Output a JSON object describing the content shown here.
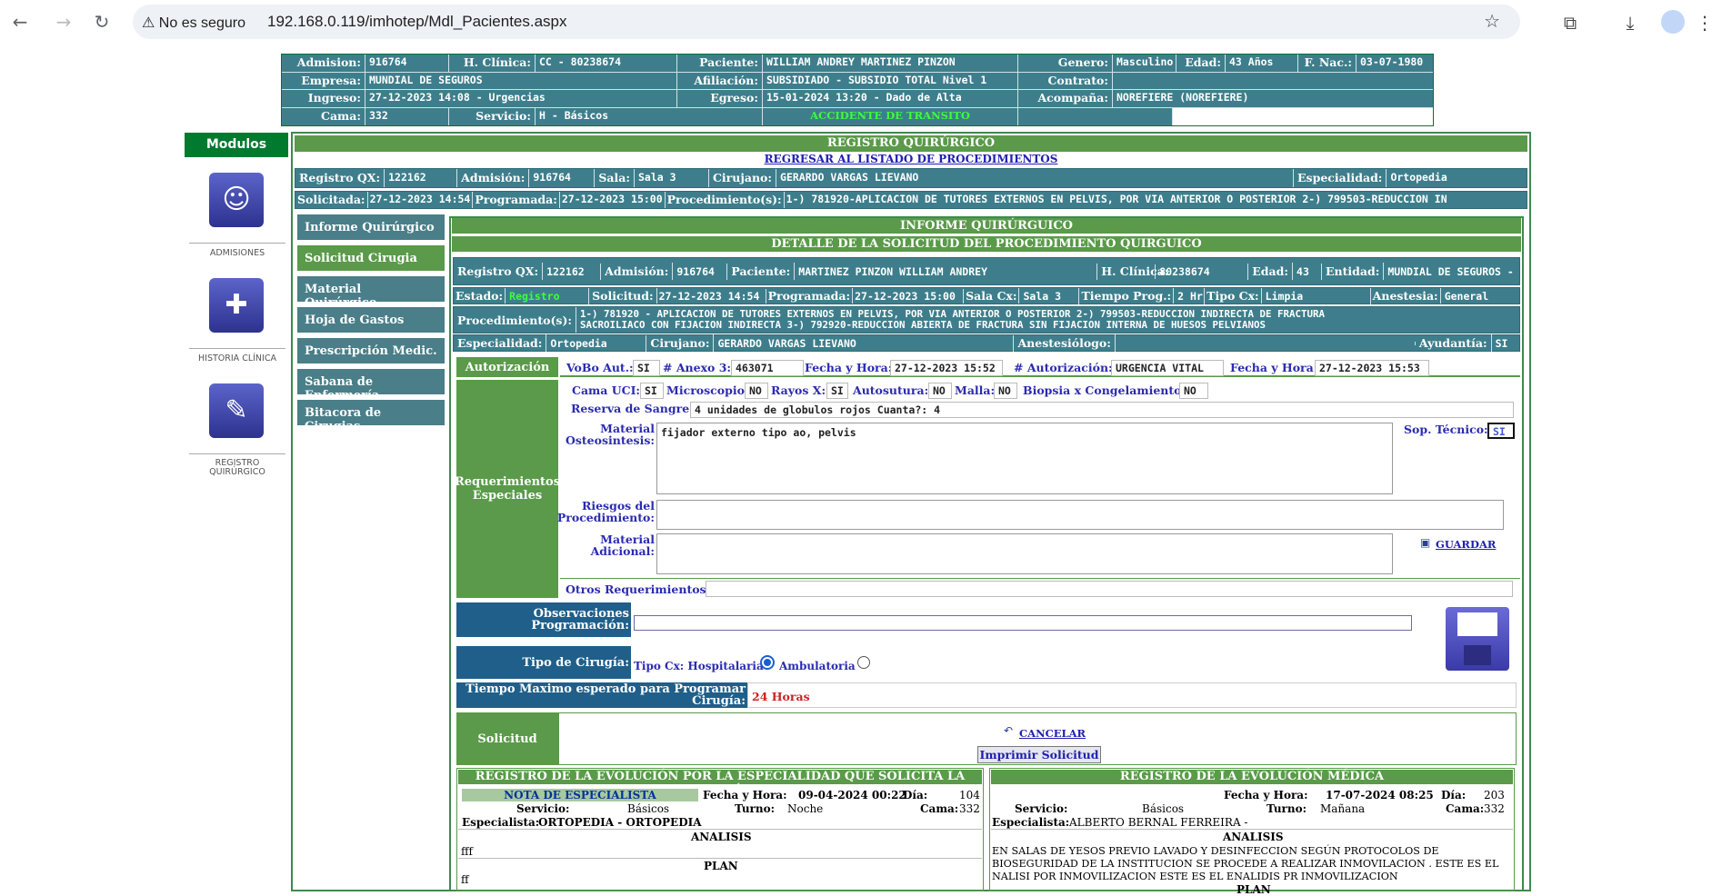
{
  "browser": {
    "secure_label": "No es seguro",
    "url": "192.168.0.119/imhotep/Mdl_Pacientes.aspx"
  },
  "patient": {
    "admision_l": "Admision:",
    "admision": "916764",
    "hclinica_l": "H. Clínica:",
    "hclinica": "CC - 80238674",
    "paciente_l": "Paciente:",
    "paciente": "WILLIAM ANDREY MARTINEZ PINZON",
    "genero_l": "Genero:",
    "genero": "Masculino",
    "edad_l": "Edad:",
    "edad": "43 Años",
    "fnac_l": "F. Nac.:",
    "fnac": "03-07-1980",
    "empresa_l": "Empresa:",
    "empresa": "MUNDIAL DE SEGUROS",
    "afiliacion_l": "Afiliación:",
    "afiliacion": "SUBSIDIADO - SUBSIDIO TOTAL Nivel 1",
    "contrato_l": "Contrato:",
    "contrato": "",
    "ingreso_l": "Ingreso:",
    "ingreso": "27-12-2023 14:08 - Urgencias",
    "egreso_l": "Egreso:",
    "egreso": "15-01-2024 13:20 - Dado de Alta",
    "acompana_l": "Acompaña:",
    "acompana": "NOREFIERE (NOREFIERE)",
    "cama_l": "Cama:",
    "cama": "332",
    "servicio_l": "Servicio:",
    "servicio": "H - Básicos",
    "accidente": "ACCIDENTE DE TRANSITO"
  },
  "modulos": {
    "title": "Modulos",
    "items": [
      {
        "label": "ADMISIONES"
      },
      {
        "label": "HISTORIA CLÍNICA"
      },
      {
        "label": "REGISTRO QUIRÚRGICO"
      }
    ]
  },
  "registro": {
    "title": "REGISTRO QUIRÚRGICO",
    "back_link": "REGRESAR AL LISTADO DE PROCEDIMIENTOS",
    "qx_l": "Registro QX:",
    "qx": "122162",
    "adm_l": "Admisión:",
    "adm": "916764",
    "sala_l": "Sala:",
    "sala": "Sala 3",
    "cirujano_l": "Cirujano:",
    "cirujano": "GERARDO VARGAS LIEVANO",
    "esp_l": "Especialidad:",
    "esp": "Ortopedia",
    "solicitada_l": "Solicitada:",
    "solicitada": "27-12-2023 14:54",
    "programada_l": "Programada:",
    "programada": "27-12-2023 15:00",
    "proc_l": "Procedimiento(s):",
    "proc": "1-) 781920-APLICACION DE TUTORES EXTERNOS EN PELVIS, POR VIA ANTERIOR O POSTERIOR 2-) 799503-REDUCCION IN"
  },
  "menu": [
    "Informe Quirúrgico",
    "Solicitud Cirugia",
    "Material Quirúrgico",
    "Hoja de Gastos",
    "Prescripción Medic.",
    "Sabana de Enfermería",
    "Bitacora de Cirugias"
  ],
  "informe": {
    "title": "INFORME QUIRÚRGUICO",
    "subtitle": "DETALLE DE LA SOLICITUD DEL PROCEDIMIENTO QUIRGUICO",
    "qx_l": "Registro QX:",
    "qx": "122162",
    "adm_l": "Admisión:",
    "adm": "916764",
    "pac_l": "Paciente:",
    "pac": "MARTINEZ PINZON WILLIAM ANDREY",
    "hc_l": "H. Clínica:",
    "hc": "80238674",
    "edad_l": "Edad:",
    "edad": "43",
    "ent_l": "Entidad:",
    "ent": "MUNDIAL DE SEGUROS - CA",
    "estado_l": "Estado:",
    "estado": "Registro",
    "sol_l": "Solicitud:",
    "sol": "27-12-2023 14:54",
    "prog_l": "Programada:",
    "prog": "27-12-2023 15:00",
    "salacx_l": "Sala Cx:",
    "salacx": "Sala 3",
    "tprog_l": "Tiempo Prog.:",
    "tprog": "2 Hr",
    "tipocx_l": "Tipo Cx:",
    "tipocx": "Limpia",
    "anest_l": "Anestesia:",
    "anest": "General",
    "proc_l": "Procedimiento(s):",
    "proc1": "1-) 781920 - APLICACION DE TUTORES EXTERNOS EN PELVIS, POR VIA ANTERIOR O POSTERIOR 2-) 799503-REDUCCION INDIRECTA DE FRACTURA",
    "proc2": "SACROILIACO CON FIJACION INDIRECTA 3-) 792920-REDUCCION ABIERTA DE FRACTURA SIN FIJACION INTERNA DE HUESOS PELVIANOS",
    "esp_l": "Especialidad:",
    "esp": "Ortopedia",
    "cir_l": "Cirujano:",
    "cir": "GERARDO VARGAS LIEVANO",
    "anestesiologo_l": "Anestesiólogo:",
    "anestesiologo": "",
    "ayud_l": "Ayudantía:",
    "ayud": "SI"
  },
  "autorizacion": {
    "title": "Autorización",
    "vobo_l": "VoBo Aut.:",
    "vobo": "SI",
    "anexo_l": "# Anexo 3:",
    "anexo": "463071",
    "fh1_l": "Fecha y Hora:",
    "fh1": "27-12-2023 15:52",
    "aut_l": "# Autorización:",
    "aut": "URGENCIA VITAL",
    "fh2_l": "Fecha y Hora:",
    "fh2": "27-12-2023 15:53"
  },
  "requerimientos": {
    "title": "Requerimientos Especiales",
    "uci_l": "Cama UCI:",
    "uci": "SI",
    "micro_l": "Microscopio:",
    "micro": "NO",
    "rayos_l": "Rayos X:",
    "rayos": "SI",
    "auto_l": "Autosutura:",
    "auto": "NO",
    "malla_l": "Malla:",
    "malla": "NO",
    "biop_l": "Biopsia x Congelamiento:",
    "biop": "NO",
    "sangre_l": "Reserva de Sangre:",
    "sangre": "4 unidades de globulos rojos Cuanta?: 4",
    "osteo_l": "Material Osteosintesis:",
    "osteo": "fijador externo tipo ao, pelvis",
    "sop_l": "Sop. Técnico:",
    "sop": "SI",
    "riesgos_l": "Riesgos del Procedimiento:",
    "riesgos": "",
    "adicional_l": "Material Adicional:",
    "adicional": "",
    "guardar": "GUARDAR",
    "otros_l": "Otros Requerimientos:",
    "otros": ""
  },
  "programacion": {
    "obs_l": "Observaciones Programación:",
    "obs": "",
    "tipo_l": "Tipo de Cirugía:",
    "tipo_text": "Tipo Cx: Hospitalaria",
    "amb": "Ambulatoria",
    "tiempo_l": "Tiempo Maximo esperado para Programar Cirugía:",
    "tiempo": "24 Horas"
  },
  "solicitud": {
    "title": "Solicitud",
    "cancelar": "CANCELAR",
    "imprimir": "Imprimir Solicitud"
  },
  "evol_esp": {
    "title": "REGISTRO DE LA EVOLUCIÓN POR LA ESPECIALIDAD QUE SOLICITA LA CIRUGÍA",
    "nota": "NOTA DE ESPECIALISTA",
    "fh_l": "Fecha y Hora:",
    "fh": "09-04-2024 00:22",
    "dia_l": "Día:",
    "dia": "104",
    "serv_l": "Servicio:",
    "serv": "Básicos",
    "turno_l": "Turno:",
    "turno": "Noche",
    "cama_l": "Cama:",
    "cama": "332",
    "esp_l": "Especialista:",
    "esp": "ORTOPEDIA - ORTOPEDIA",
    "analisis_l": "ANALISIS",
    "analisis": "fff",
    "plan_l": "PLAN",
    "plan": "ff"
  },
  "evol_med": {
    "title": "REGISTRO DE LA EVOLUCIÓN MÉDICA",
    "fh_l": "Fecha y Hora:",
    "fh": "17-07-2024 08:25",
    "dia_l": "Día:",
    "dia": "203",
    "serv_l": "Servicio:",
    "serv": "Básicos",
    "turno_l": "Turno:",
    "turno": "Mañana",
    "cama_l": "Cama:",
    "cama": "332",
    "esp_l": "Especialista:",
    "esp": "ALBERTO BERNAL FERREIRA -",
    "analisis_l": "ANALISIS",
    "an1": "EN SALAS DE YESOS PREVIO LAVADO Y DESINFECCION SEGÚN PROTOCOLOS DE",
    "an2": "BIOSEGURIDAD DE LA INSTITUCION SE PROCEDE A REALIZAR INMOVILACION . ESTE ES EL",
    "an3": "NALISI POR INMOVILIZACION ESTE ES EL ENALIDIS PR INMOVILIZACION",
    "plan_l": "PLAN"
  }
}
